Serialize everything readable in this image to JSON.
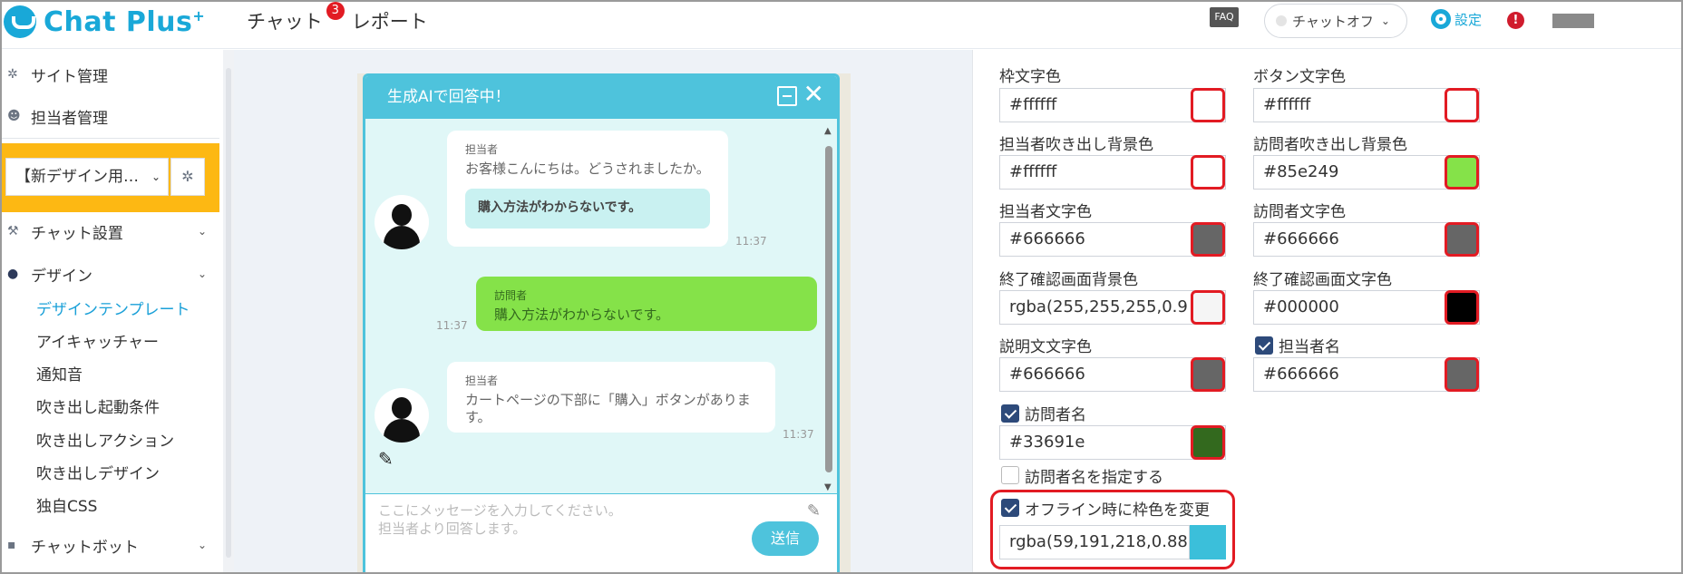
{
  "header": {
    "logo_text": "Chat Plus",
    "logo_plus": "+",
    "nav": [
      {
        "label": "チャット",
        "badge": "3"
      },
      {
        "label": "レポート"
      }
    ],
    "faq_label": "FAQ",
    "chat_status_label": "チャットオフ",
    "settings_label": "設定",
    "alert_label": "!"
  },
  "sidebar": {
    "items": [
      {
        "label": "サイト管理",
        "icon": "gear-icon"
      },
      {
        "label": "担当者管理",
        "icon": "users-icon"
      }
    ],
    "site_select_value": "【新デザイン用…",
    "sections": [
      {
        "label": "チャット設置",
        "icon": "wrench-icon"
      },
      {
        "label": "デザイン",
        "icon": "palette-icon"
      }
    ],
    "design_sub": [
      "デザインテンプレート",
      "アイキャッチャー",
      "通知音",
      "吹き出し起動条件",
      "吹き出しアクション",
      "吹き出しデザイン",
      "独自CSS"
    ],
    "chatbot_label": "チャットボット"
  },
  "chat": {
    "title": "生成AIで回答中！",
    "messages": [
      {
        "who": "担当者",
        "text": "お客様こんにちは。どうされましたか。",
        "quick_reply": "購入方法がわからないです。",
        "time": "11:37"
      },
      {
        "who": "訪問者",
        "text": "購入方法がわからないです。",
        "time": "11:37"
      },
      {
        "who": "担当者",
        "text": "カートページの下部に「購入」ボタンがありま\nす。",
        "time": "11:37"
      }
    ],
    "input_placeholder": "ここにメッセージを入力してください。\n担当者より回答します。",
    "send_label": "送信"
  },
  "colors": {
    "frame": "#ffffff",
    "button_text": "#ffffff",
    "agent_bubble_bg": "#ffffff",
    "visitor_bubble_bg": "#85e249",
    "agent_text": "#666666",
    "visitor_text": "#666666",
    "end_screen_bg_swatch": "#f5f5f5",
    "end_screen_text": "#000000",
    "desc_text": "#666666",
    "agent_name": "#666666",
    "visitor_name": "#33691e",
    "offline_frame": "#3bbfda",
    "accent": "#4ec3dc",
    "highlight": "#e21b23"
  },
  "settings": {
    "left": [
      {
        "label": "枠文字色",
        "value": "#ffffff"
      },
      {
        "label": "担当者吹き出し背景色",
        "value": "#ffffff"
      },
      {
        "label": "担当者文字色",
        "value": "#666666"
      },
      {
        "label": "終了確認画面背景色",
        "value": "rgba(255,255,255,0.9"
      },
      {
        "label": "説明文文字色",
        "value": "#666666"
      }
    ],
    "right": [
      {
        "label": "ボタン文字色",
        "value": "#ffffff"
      },
      {
        "label": "訪問者吹き出し背景色",
        "value": "#85e249"
      },
      {
        "label": "訪問者文字色",
        "value": "#666666"
      },
      {
        "label": "終了確認画面文字色",
        "value": "#000000"
      },
      {
        "label": "担当者名",
        "value": "#666666",
        "checked": true
      }
    ],
    "visitor_name": {
      "label": "訪問者名",
      "value": "#33691e",
      "checked": true
    },
    "specify_visitor_name": {
      "label": "訪問者名を指定する",
      "checked": false
    },
    "offline_frame": {
      "label": "オフライン時に枠色を変更",
      "value": "rgba(59,191,218,0.88",
      "checked": true
    }
  }
}
